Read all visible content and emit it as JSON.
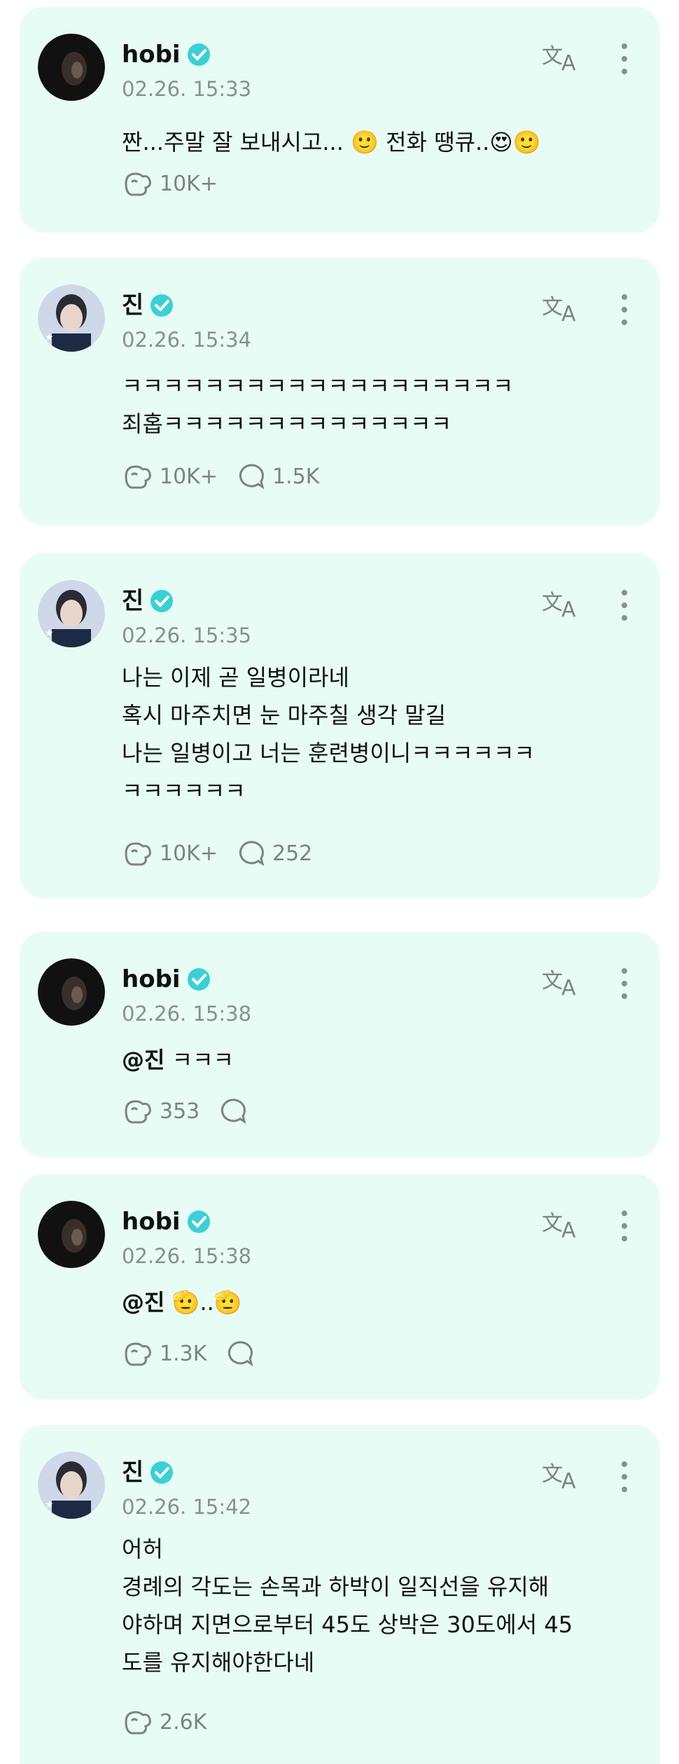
{
  "colors": {
    "card_bg": "#e6fcf4",
    "verified": "#3ccfd6",
    "muted": "#8a8f8f"
  },
  "posts": [
    {
      "author": "hobi",
      "timestamp": "02.26. 15:33",
      "text": "짠...주말 잘 보내시고... 🙂 전화 땡큐..😍🙂",
      "likes": "10K+",
      "comments": ""
    },
    {
      "author": "진",
      "timestamp": "02.26. 15:34",
      "text": "ㅋㅋㅋㅋㅋㅋㅋㅋㅋㅋㅋㅋㅋㅋㅋㅋㅋㅋㅋ\n죄홉ㅋㅋㅋㅋㅋㅋㅋㅋㅋㅋㅋㅋㅋㅋ",
      "likes": "10K+",
      "comments": "1.5K"
    },
    {
      "author": "진",
      "timestamp": "02.26. 15:35",
      "text": "나는 이제 곧 일병이라네\n혹시 마주치면 눈 마주칠 생각 말길\n나는 일병이고 너는 훈련병이니ㅋㅋㅋㅋㅋㅋ\nㅋㅋㅋㅋㅋㅋ",
      "likes": "10K+",
      "comments": "252"
    },
    {
      "author": "hobi",
      "timestamp": "02.26. 15:38",
      "mention": "@진",
      "text": " ㅋㅋㅋ",
      "likes": "353",
      "comments": ""
    },
    {
      "author": "hobi",
      "timestamp": "02.26. 15:38",
      "mention": "@진",
      "text": " 🫡..🫡",
      "likes": "1.3K",
      "comments": ""
    },
    {
      "author": "진",
      "timestamp": "02.26. 15:42",
      "text": "어허\n경례의 각도는 손목과 하박이 일직선을 유지해\n야하며 지면으로부터 45도 상박은 30도에서 45\n도를 유지해야한다네",
      "likes": "2.6K",
      "comments": ""
    }
  ]
}
